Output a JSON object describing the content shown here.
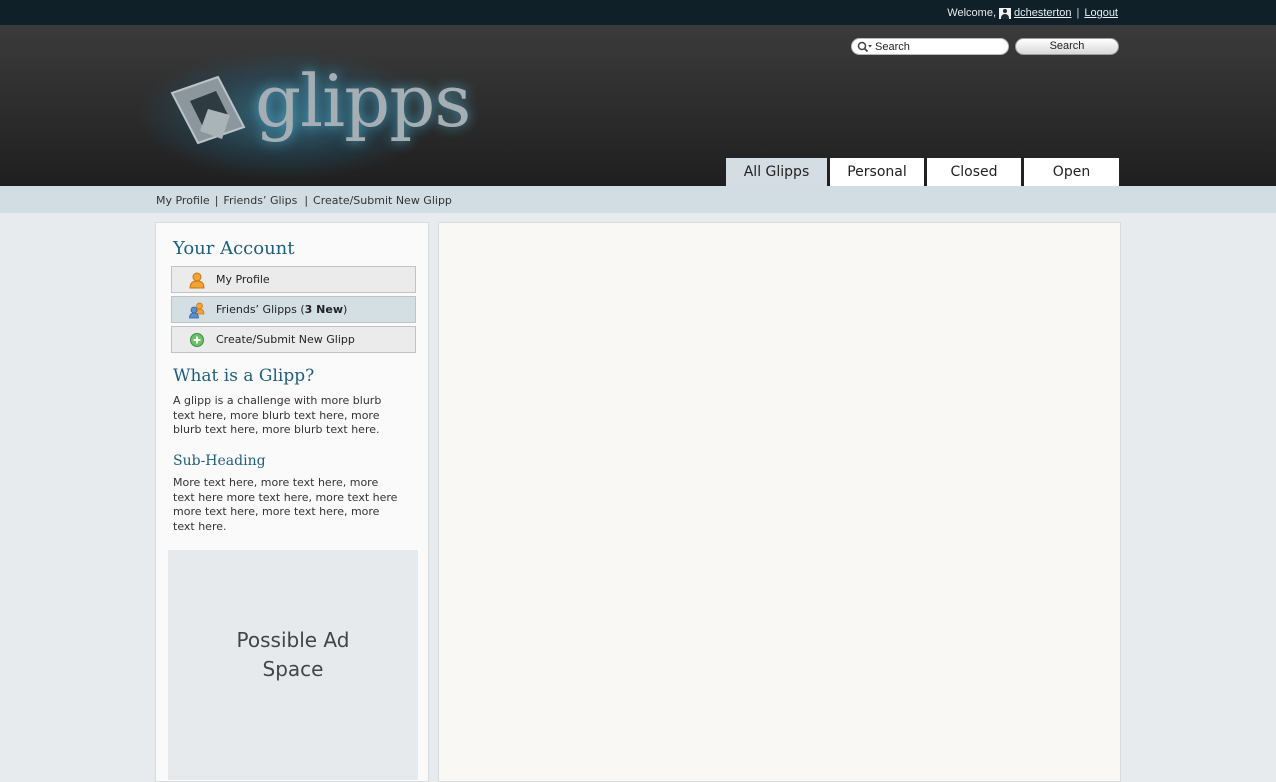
{
  "topbar": {
    "welcome_label": "Welcome,",
    "username": "dchesterton",
    "separator": "|",
    "logout_label": "Logout"
  },
  "header": {
    "logo_text": "glipps",
    "search": {
      "placeholder": "Search",
      "button_label": "Search"
    },
    "tabs": [
      {
        "label": "All Glipps",
        "active": true
      },
      {
        "label": "Personal",
        "active": false
      },
      {
        "label": "Closed",
        "active": false
      },
      {
        "label": "Open",
        "active": false
      }
    ]
  },
  "subnav": {
    "items": [
      "My Profile",
      "Friends’ Glips",
      "Create/Submit New Glipp"
    ],
    "separator": "|"
  },
  "sidebar": {
    "account_heading": "Your Account",
    "account_items": [
      {
        "label": "My Profile",
        "icon": "user-icon"
      },
      {
        "label_prefix": "Friends’ Glipps (",
        "label_bold": "3 New",
        "label_suffix": ")",
        "icon": "friends-icon"
      },
      {
        "label": "Create/Submit New Glipp",
        "icon": "add-icon"
      }
    ],
    "what_heading": "What is a Glipp?",
    "what_text": "A glipp is a challenge with more blurb text here, more blurb text here, more blurb text here, more blurb text here.",
    "sub_heading": "Sub-Heading",
    "sub_text": "More text here, more text here, more text here more text here, more text here more text here, more text here, more text here.",
    "ad_text": "Possible Ad Space"
  },
  "colors": {
    "topbar": "#102029",
    "heading": "#1f5f7a",
    "subnav": "#d2dde3",
    "active_tab": "#d3dde3"
  }
}
